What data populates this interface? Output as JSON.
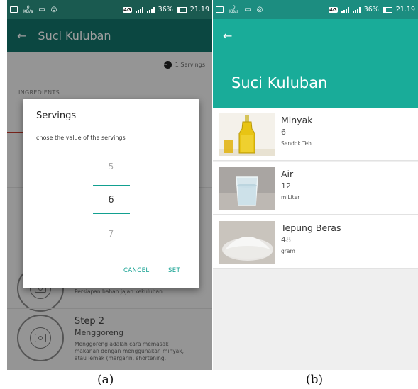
{
  "status_bar": {
    "kbs": "0\nKB/s",
    "network": "4G",
    "battery": "36%",
    "time": "21.19"
  },
  "screen_a": {
    "title": "Suci Kuluban",
    "back_icon": "arrow-left-icon",
    "servings_label": "1 Servings",
    "ingredients_header": "INGREDIENTS",
    "step1_desc": "Persiapan bahan jajan kekuluban",
    "step2": {
      "title": "Step 2",
      "subtitle": "Menggoreng",
      "desc_lines": [
        "Menggoreng adalah cara memasak",
        "makanan dengan menggunakan minyak,",
        "atau lemak (margarin, shortening,"
      ]
    },
    "dialog": {
      "title": "Servings",
      "message": "chose the value of the servings",
      "picker": {
        "prev": "5",
        "selected": "6",
        "next": "7"
      },
      "cancel": "CANCEL",
      "set": "SET"
    }
  },
  "screen_b": {
    "back_icon": "arrow-left-icon",
    "title": "Suci Kuluban",
    "ingredients": [
      {
        "name": "Minyak",
        "qty": "6",
        "unit": "Sendok Teh"
      },
      {
        "name": "Air",
        "qty": "12",
        "unit": "mlLiter"
      },
      {
        "name": "Tepung Beras",
        "qty": "48",
        "unit": "gram"
      }
    ]
  },
  "captions": {
    "a": "(a)",
    "b": "(b)"
  }
}
